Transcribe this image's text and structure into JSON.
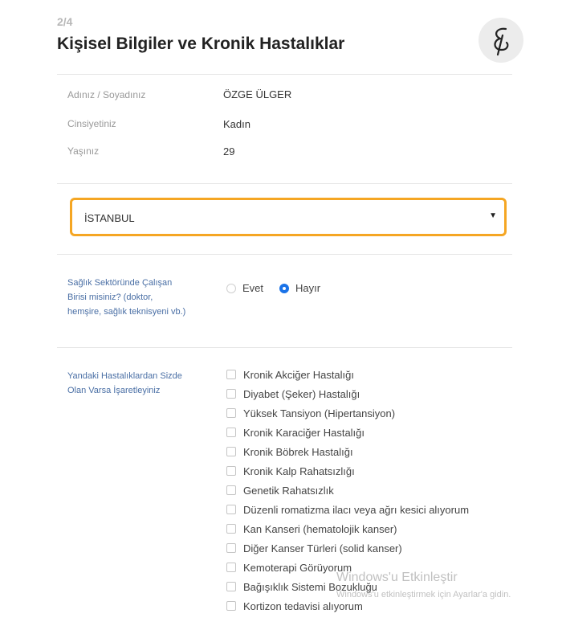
{
  "header": {
    "step": "2/4",
    "title": "Kişisel Bilgiler ve Kronik Hastalıklar"
  },
  "info": [
    {
      "label": "Adınız / Soyadınız",
      "value": "ÖZGE ÜLGER"
    },
    {
      "label": "Cinsiyetiniz",
      "value": "Kadın"
    },
    {
      "label": "Yaşınız",
      "value": "29"
    }
  ],
  "city_select": {
    "value": "İSTANBUL",
    "arrow": "▼"
  },
  "health_sector": {
    "question_lines": [
      "Sağlık Sektöründe Çalışan",
      "Birisi misiniz? (doktor,",
      "hemşire, sağlık teknisyeni vb.)"
    ],
    "options": [
      "Evet",
      "Hayır"
    ],
    "selected": "Hayır"
  },
  "diseases": {
    "question_lines": [
      "Yandaki Hastalıklardan Sizde",
      "Olan Varsa İşaretleyiniz"
    ],
    "items": [
      "Kronik Akciğer Hastalığı",
      "Diyabet (Şeker) Hastalığı",
      "Yüksek Tansiyon (Hipertansiyon)",
      "Kronik Karaciğer Hastalığı",
      "Kronik Böbrek Hastalığı",
      "Kronik Kalp Rahatsızlığı",
      "Genetik Rahatsızlık",
      "Düzenli romatizma ilacı veya ağrı kesici alıyorum",
      "Kan Kanseri (hematolojik kanser)",
      "Diğer Kanser Türleri (solid kanser)",
      "Kemoterapi Görüyorum",
      "Bağışıklık Sistemi Bozukluğu",
      "Kortizon tedavisi alıyorum"
    ]
  },
  "watermark": {
    "title": "Windows'u Etkinleştir",
    "subtitle": "Windows'u etkinleştirmek için Ayarlar'a gidin."
  },
  "colors": {
    "accent_orange": "#f5a623",
    "radio_blue": "#1a73e8",
    "label_blue": "#4a6fa5"
  }
}
